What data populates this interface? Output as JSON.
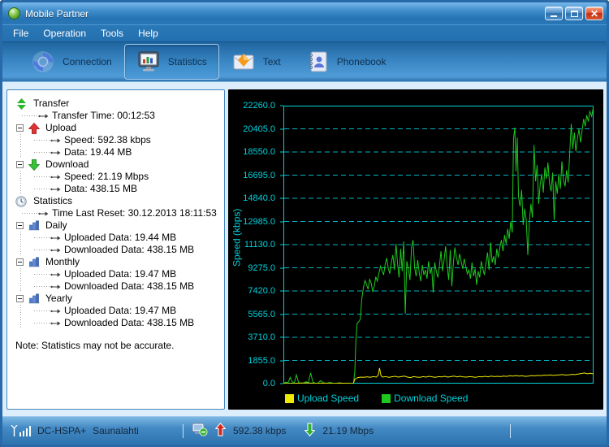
{
  "window": {
    "title": "Mobile Partner",
    "controls": [
      "minimize",
      "maximize",
      "close"
    ]
  },
  "menu": {
    "items": [
      "File",
      "Operation",
      "Tools",
      "Help"
    ]
  },
  "toolbar": {
    "items": [
      {
        "id": "connection",
        "label": "Connection",
        "selected": false
      },
      {
        "id": "statistics",
        "label": "Statistics",
        "selected": true
      },
      {
        "id": "text",
        "label": "Text",
        "selected": false
      },
      {
        "id": "phonebook",
        "label": "Phonebook",
        "selected": false
      }
    ]
  },
  "tree": {
    "nodes": [
      {
        "type": "root",
        "icon": "transfer",
        "label": "Transfer"
      },
      {
        "type": "leaf",
        "level": 1,
        "label": "Transfer Time: 00:12:53"
      },
      {
        "type": "group",
        "icon": "upload",
        "label": "Upload"
      },
      {
        "type": "leaf",
        "level": 2,
        "label": "Speed: 592.38 kbps"
      },
      {
        "type": "leaf",
        "level": 2,
        "label": "Data: 19.44 MB"
      },
      {
        "type": "group",
        "icon": "download",
        "label": "Download"
      },
      {
        "type": "leaf",
        "level": 2,
        "label": "Speed: 21.19 Mbps"
      },
      {
        "type": "leaf",
        "level": 2,
        "label": "Data: 438.15 MB"
      },
      {
        "type": "root",
        "icon": "clock",
        "label": "Statistics"
      },
      {
        "type": "leaf",
        "level": 1,
        "label": "Time Last Reset: 30.12.2013 18:11:53"
      },
      {
        "type": "group",
        "icon": "chart",
        "label": "Daily"
      },
      {
        "type": "leaf",
        "level": 2,
        "label": "Uploaded Data: 19.44 MB"
      },
      {
        "type": "leaf",
        "level": 2,
        "label": "Downloaded Data: 438.15 MB"
      },
      {
        "type": "group",
        "icon": "chart",
        "label": "Monthly"
      },
      {
        "type": "leaf",
        "level": 2,
        "label": "Uploaded Data: 19.47 MB"
      },
      {
        "type": "leaf",
        "level": 2,
        "label": "Downloaded Data: 438.15 MB"
      },
      {
        "type": "group",
        "icon": "chart",
        "label": "Yearly"
      },
      {
        "type": "leaf",
        "level": 2,
        "label": "Uploaded Data: 19.47 MB"
      },
      {
        "type": "leaf",
        "level": 2,
        "label": "Downloaded Data: 438.15 MB"
      }
    ],
    "note": "Note: Statistics may not be accurate."
  },
  "chart_data": {
    "type": "line",
    "ylabel": "Speed (kbps)",
    "ylim": [
      0,
      22260
    ],
    "ytick_interval": 1855,
    "ytick_decimals": 1,
    "grid": "horizontal-dashed",
    "background": "#000000",
    "axis_color": "#00d2dc",
    "grid_color": "#00b4c4",
    "legend_position": "bottom-left",
    "x_unit": "percent-of-timeline",
    "series": [
      {
        "name": "Upload Speed",
        "color": "#f0ea00",
        "points": [
          [
            0,
            10
          ],
          [
            3,
            20
          ],
          [
            6,
            50
          ],
          [
            8,
            60
          ],
          [
            10,
            15
          ],
          [
            13,
            35
          ],
          [
            16,
            20
          ],
          [
            19,
            30
          ],
          [
            22,
            15
          ],
          [
            22.6,
            10
          ],
          [
            23,
            350
          ],
          [
            24,
            480
          ],
          [
            25,
            520
          ],
          [
            26,
            500
          ],
          [
            27,
            545
          ],
          [
            28,
            510
          ],
          [
            29,
            560
          ],
          [
            30,
            520
          ],
          [
            30.6,
            690
          ],
          [
            31,
            1250
          ],
          [
            31.5,
            620
          ],
          [
            32,
            520
          ],
          [
            33,
            560
          ],
          [
            34,
            500
          ],
          [
            35,
            545
          ],
          [
            36,
            585
          ],
          [
            37,
            520
          ],
          [
            38,
            560
          ],
          [
            39,
            600
          ],
          [
            40,
            520
          ],
          [
            41,
            480
          ],
          [
            42,
            560
          ],
          [
            43,
            520
          ],
          [
            44,
            500
          ],
          [
            45,
            560
          ],
          [
            46,
            520
          ],
          [
            47,
            585
          ],
          [
            48,
            540
          ],
          [
            49,
            500
          ],
          [
            50,
            560
          ],
          [
            51,
            540
          ],
          [
            52,
            585
          ],
          [
            53,
            520
          ],
          [
            54,
            560
          ],
          [
            55,
            600
          ],
          [
            56,
            540
          ],
          [
            57,
            585
          ],
          [
            58,
            540
          ],
          [
            59,
            520
          ],
          [
            60,
            560
          ],
          [
            61,
            540
          ],
          [
            62,
            500
          ],
          [
            63,
            560
          ],
          [
            64,
            540
          ],
          [
            65,
            585
          ],
          [
            66,
            540
          ],
          [
            67,
            600
          ],
          [
            68,
            560
          ],
          [
            69,
            585
          ],
          [
            70,
            560
          ],
          [
            71,
            600
          ],
          [
            72,
            580
          ],
          [
            73,
            625
          ],
          [
            74,
            600
          ],
          [
            75,
            645
          ],
          [
            76,
            600
          ],
          [
            77,
            625
          ],
          [
            78,
            580
          ],
          [
            79,
            600
          ],
          [
            80,
            645
          ],
          [
            81,
            620
          ],
          [
            82,
            660
          ],
          [
            83,
            640
          ],
          [
            84,
            685
          ],
          [
            85,
            660
          ],
          [
            86,
            705
          ],
          [
            87,
            660
          ],
          [
            88,
            685
          ],
          [
            89,
            705
          ],
          [
            90,
            725
          ],
          [
            91,
            685
          ],
          [
            92,
            705
          ],
          [
            93,
            745
          ],
          [
            94,
            725
          ],
          [
            95,
            765
          ],
          [
            96,
            805
          ],
          [
            97,
            855
          ],
          [
            98,
            785
          ],
          [
            99,
            825
          ],
          [
            100,
            765
          ]
        ]
      },
      {
        "name": "Download Speed",
        "color": "#1ec81e",
        "points": [
          [
            0,
            30
          ],
          [
            0.8,
            120
          ],
          [
            1.5,
            60
          ],
          [
            2.2,
            500
          ],
          [
            2.8,
            150
          ],
          [
            3.5,
            40
          ],
          [
            4.2,
            700
          ],
          [
            4.9,
            80
          ],
          [
            5.6,
            30
          ],
          [
            6.5,
            20
          ],
          [
            7.3,
            160
          ],
          [
            8,
            60
          ],
          [
            8.8,
            850
          ],
          [
            9.5,
            120
          ],
          [
            10.3,
            40
          ],
          [
            11,
            20
          ],
          [
            12,
            230
          ],
          [
            13,
            60
          ],
          [
            14,
            30
          ],
          [
            15,
            90
          ],
          [
            16,
            40
          ],
          [
            17,
            25
          ],
          [
            18,
            70
          ],
          [
            19,
            35
          ],
          [
            20,
            20
          ],
          [
            21,
            45
          ],
          [
            22,
            15
          ],
          [
            22.6,
            10
          ],
          [
            23,
            900
          ],
          [
            23.4,
            3600
          ],
          [
            23.8,
            4850
          ],
          [
            24.3,
            4950
          ],
          [
            24.8,
            5150
          ],
          [
            25.3,
            6800
          ],
          [
            25.8,
            7700
          ],
          [
            26.3,
            8250
          ],
          [
            26.8,
            7950
          ],
          [
            27.3,
            7550
          ],
          [
            27.8,
            8350
          ],
          [
            28.3,
            8050
          ],
          [
            28.8,
            7350
          ],
          [
            29.3,
            7800
          ],
          [
            29.8,
            8550
          ],
          [
            30.3,
            8200
          ],
          [
            30.8,
            8850
          ],
          [
            31.3,
            9400
          ],
          [
            31.8,
            9050
          ],
          [
            32.3,
            8700
          ],
          [
            32.8,
            9550
          ],
          [
            33.3,
            10050
          ],
          [
            33.8,
            9250
          ],
          [
            34.3,
            8800
          ],
          [
            34.8,
            9700
          ],
          [
            35.3,
            10300
          ],
          [
            35.8,
            9100
          ],
          [
            36.3,
            11200
          ],
          [
            36.8,
            9600
          ],
          [
            37.3,
            8500
          ],
          [
            37.8,
            10800
          ],
          [
            38.3,
            9000
          ],
          [
            38.8,
            11400
          ],
          [
            39.3,
            5600
          ],
          [
            39.8,
            9800
          ],
          [
            40.3,
            9200
          ],
          [
            40.8,
            8300
          ],
          [
            41.3,
            10900
          ],
          [
            41.8,
            11500
          ],
          [
            42.3,
            9300
          ],
          [
            42.8,
            8600
          ],
          [
            43.3,
            9900
          ],
          [
            43.8,
            8900
          ],
          [
            44.3,
            8200
          ],
          [
            44.8,
            9500
          ],
          [
            45.3,
            8700
          ],
          [
            45.8,
            9100
          ],
          [
            46.3,
            8400
          ],
          [
            46.8,
            9800
          ],
          [
            47.3,
            8800
          ],
          [
            47.8,
            9300
          ],
          [
            48.3,
            7300
          ],
          [
            48.8,
            9700
          ],
          [
            49.3,
            9000
          ],
          [
            49.8,
            8500
          ],
          [
            50.3,
            9400
          ],
          [
            50.8,
            10600
          ],
          [
            51.3,
            9000
          ],
          [
            51.8,
            9900
          ],
          [
            52.3,
            11000
          ],
          [
            52.8,
            9400
          ],
          [
            53.3,
            8300
          ],
          [
            53.8,
            10700
          ],
          [
            54.3,
            7800
          ],
          [
            54.8,
            9600
          ],
          [
            55.3,
            10900
          ],
          [
            55.8,
            10100
          ],
          [
            56.3,
            9500
          ],
          [
            56.8,
            10400
          ],
          [
            57.3,
            9800
          ],
          [
            57.8,
            9200
          ],
          [
            58.3,
            10000
          ],
          [
            58.8,
            9400
          ],
          [
            59.3,
            8800
          ],
          [
            59.8,
            9100
          ],
          [
            60.3,
            8400
          ],
          [
            60.8,
            9700
          ],
          [
            61.3,
            8600
          ],
          [
            61.8,
            9200
          ],
          [
            62.3,
            7900
          ],
          [
            62.8,
            9000
          ],
          [
            63.3,
            8500
          ],
          [
            63.8,
            9800
          ],
          [
            64.3,
            9200
          ],
          [
            64.8,
            8700
          ],
          [
            65.3,
            9600
          ],
          [
            65.8,
            10500
          ],
          [
            66.3,
            9100
          ],
          [
            66.8,
            11300
          ],
          [
            67.3,
            9700
          ],
          [
            67.8,
            10200
          ],
          [
            68.3,
            9500
          ],
          [
            68.8,
            10800
          ],
          [
            69.3,
            10100
          ],
          [
            69.8,
            10900
          ],
          [
            70.3,
            11500
          ],
          [
            70.8,
            10600
          ],
          [
            71.3,
            11900
          ],
          [
            71.8,
            11200
          ],
          [
            72.3,
            12400
          ],
          [
            72.8,
            11600
          ],
          [
            73.3,
            13000
          ],
          [
            73.8,
            12100
          ],
          [
            74.2,
            19600
          ],
          [
            74.6,
            20500
          ],
          [
            75,
            17000
          ],
          [
            75.4,
            19700
          ],
          [
            75.8,
            14900
          ],
          [
            76.3,
            14200
          ],
          [
            76.8,
            15500
          ],
          [
            77.3,
            12700
          ],
          [
            77.8,
            14000
          ],
          [
            78.3,
            13100
          ],
          [
            78.8,
            10300
          ],
          [
            79.3,
            12900
          ],
          [
            79.8,
            14400
          ],
          [
            80.3,
            13300
          ],
          [
            80.8,
            19100
          ],
          [
            81.3,
            16200
          ],
          [
            81.8,
            17500
          ],
          [
            82.3,
            14400
          ],
          [
            82.8,
            16000
          ],
          [
            83.3,
            16800
          ],
          [
            83.8,
            15300
          ],
          [
            84.3,
            17300
          ],
          [
            84.8,
            16400
          ],
          [
            85.3,
            17700
          ],
          [
            85.8,
            16000
          ],
          [
            86.3,
            15400
          ],
          [
            86.8,
            16900
          ],
          [
            87.3,
            13100
          ],
          [
            87.8,
            16200
          ],
          [
            88.3,
            15200
          ],
          [
            88.8,
            16800
          ],
          [
            89.3,
            15600
          ],
          [
            89.8,
            17800
          ],
          [
            90.3,
            16300
          ],
          [
            90.8,
            15800
          ],
          [
            91.3,
            17100
          ],
          [
            91.8,
            16100
          ],
          [
            92.3,
            18400
          ],
          [
            92.8,
            20800
          ],
          [
            93.3,
            18800
          ],
          [
            93.8,
            20100
          ],
          [
            94.3,
            18600
          ],
          [
            94.8,
            19600
          ],
          [
            95.3,
            20400
          ],
          [
            95.8,
            19300
          ],
          [
            96.3,
            20300
          ],
          [
            96.8,
            21200
          ],
          [
            97.3,
            20600
          ],
          [
            97.8,
            21500
          ],
          [
            98.3,
            21000
          ],
          [
            98.8,
            21800
          ],
          [
            99.4,
            21400
          ],
          [
            100,
            22260
          ]
        ]
      }
    ]
  },
  "statusbar": {
    "network_mode": "DC-HSPA+",
    "operator": "Saunalahti",
    "upload_speed": "592.38 kbps",
    "download_speed": "21.19 Mbps"
  }
}
